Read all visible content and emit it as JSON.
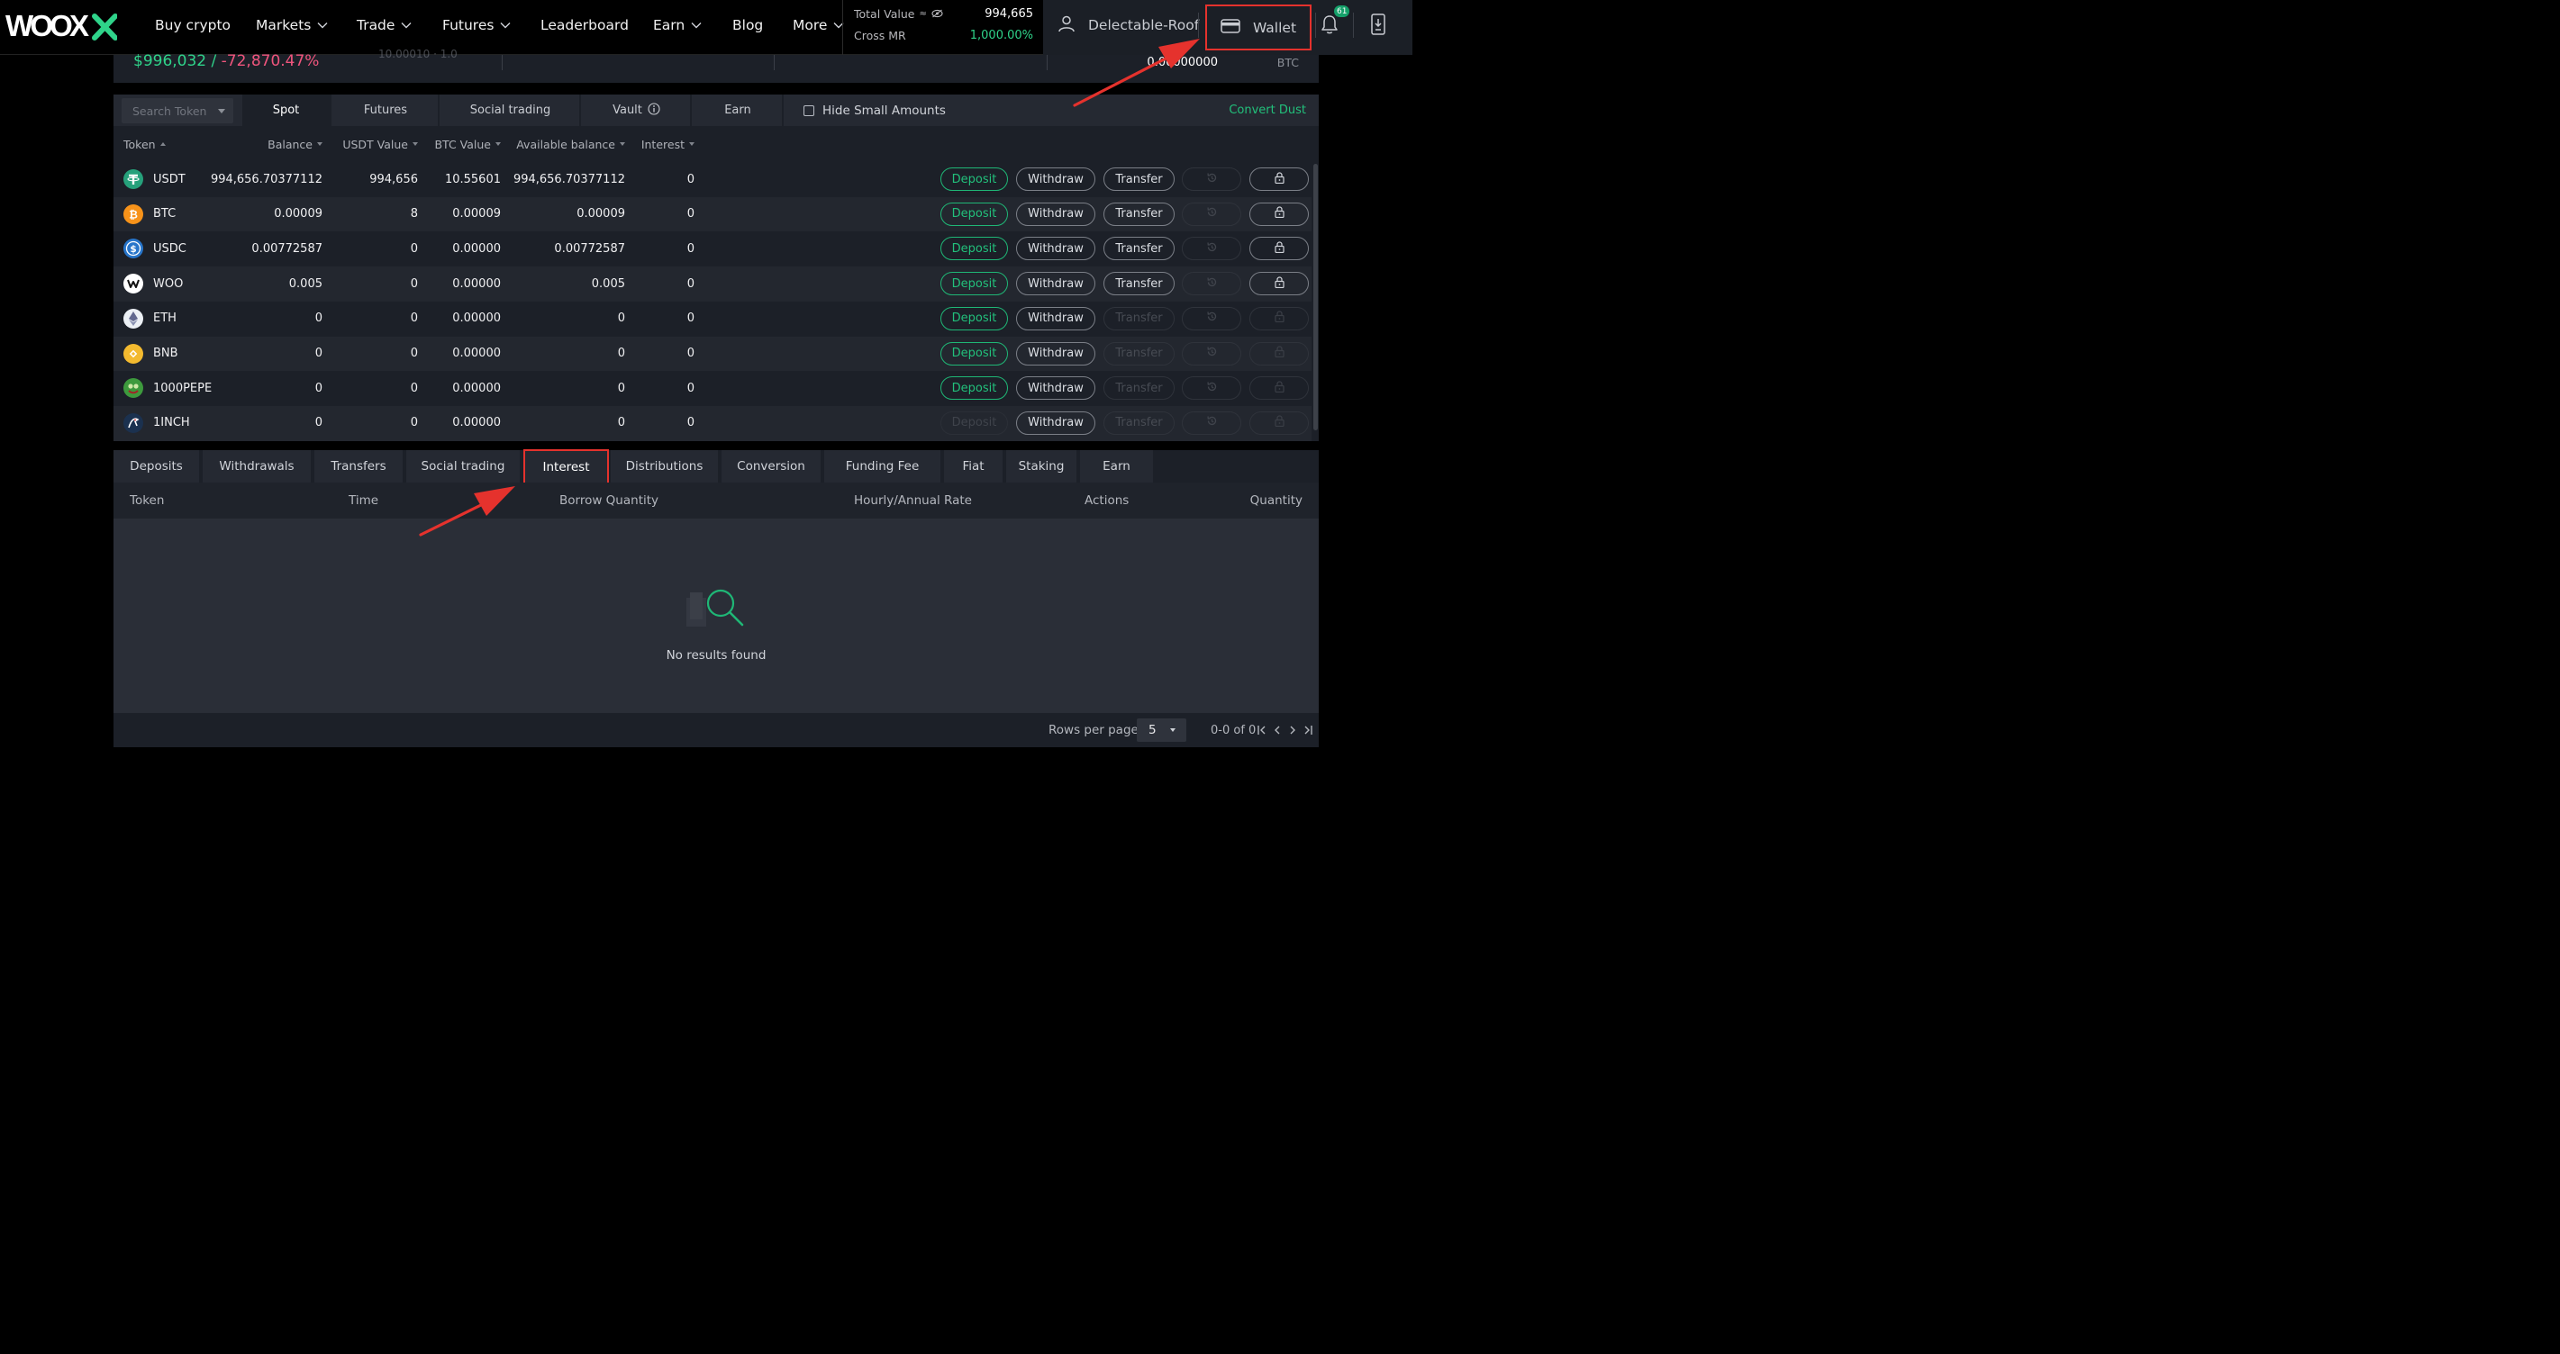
{
  "brand": {
    "logo_text": "WOOX",
    "accent": "#22c07b",
    "negative": "#f0557d",
    "highlight": "#e5322d"
  },
  "nav": {
    "items": [
      {
        "label": "Buy crypto",
        "dropdown": false
      },
      {
        "label": "Markets",
        "dropdown": true
      },
      {
        "label": "Trade",
        "dropdown": true
      },
      {
        "label": "Futures",
        "dropdown": true
      },
      {
        "label": "Leaderboard",
        "dropdown": false
      },
      {
        "label": "Earn",
        "dropdown": true
      },
      {
        "label": "Blog",
        "dropdown": false
      },
      {
        "label": "More",
        "dropdown": true
      }
    ],
    "total_value_label": "Total Value",
    "total_value_symbol": "≈",
    "total_value": "994,665",
    "cross_mr_label": "Cross MR",
    "cross_mr_value": "1,000.00%",
    "username": "Delectable-Roof",
    "wallet_label": "Wallet",
    "notification_count": "61",
    "icons": {
      "user": "user-icon",
      "wallet": "wallet-icon",
      "bell": "bell-icon",
      "download_app": "download-app-icon",
      "hide_balance": "eye-off-icon"
    }
  },
  "summary": {
    "value": "$996,032 /",
    "change": "-72,870.47%",
    "ghost_text": "10.00010 · 1.0",
    "btc_value": "0.00000000",
    "btc_unit": "BTC"
  },
  "balances": {
    "search_placeholder": "Search Token",
    "tabs": [
      {
        "label": "Spot",
        "active": true
      },
      {
        "label": "Futures",
        "active": false
      },
      {
        "label": "Social trading",
        "active": false
      },
      {
        "label": "Vault",
        "active": false,
        "info": true
      },
      {
        "label": "Earn",
        "active": false
      }
    ],
    "hide_small_label": "Hide Small Amounts",
    "hide_small_checked": false,
    "convert_dust_label": "Convert Dust",
    "columns": [
      "Token",
      "Balance",
      "USDT Value",
      "BTC Value",
      "Available balance",
      "Interest"
    ],
    "action_labels": {
      "deposit": "Deposit",
      "withdraw": "Withdraw",
      "transfer": "Transfer"
    },
    "rows": [
      {
        "token": "USDT",
        "balance": "994,656.70377112",
        "usdt_value": "994,656",
        "btc_value": "10.55601",
        "available": "994,656.70377112",
        "interest": "0",
        "deposit_enabled": true,
        "transfer_enabled": true,
        "icon": "usdt-coin-icon",
        "color": "#26a17b"
      },
      {
        "token": "BTC",
        "balance": "0.00009",
        "usdt_value": "8",
        "btc_value": "0.00009",
        "available": "0.00009",
        "interest": "0",
        "deposit_enabled": true,
        "transfer_enabled": true,
        "icon": "btc-coin-icon",
        "color": "#f7931a"
      },
      {
        "token": "USDC",
        "balance": "0.00772587",
        "usdt_value": "0",
        "btc_value": "0.00000",
        "available": "0.00772587",
        "interest": "0",
        "deposit_enabled": true,
        "transfer_enabled": true,
        "icon": "usdc-coin-icon",
        "color": "#2775ca"
      },
      {
        "token": "WOO",
        "balance": "0.005",
        "usdt_value": "0",
        "btc_value": "0.00000",
        "available": "0.005",
        "interest": "0",
        "deposit_enabled": true,
        "transfer_enabled": true,
        "icon": "woo-coin-icon",
        "color": "#ffffff"
      },
      {
        "token": "ETH",
        "balance": "0",
        "usdt_value": "0",
        "btc_value": "0.00000",
        "available": "0",
        "interest": "0",
        "deposit_enabled": true,
        "transfer_enabled": false,
        "icon": "eth-coin-icon",
        "color": "#ecf0f5"
      },
      {
        "token": "BNB",
        "balance": "0",
        "usdt_value": "0",
        "btc_value": "0.00000",
        "available": "0",
        "interest": "0",
        "deposit_enabled": true,
        "transfer_enabled": false,
        "icon": "bnb-coin-icon",
        "color": "#f3ba2f"
      },
      {
        "token": "1000PEPE",
        "balance": "0",
        "usdt_value": "0",
        "btc_value": "0.00000",
        "available": "0",
        "interest": "0",
        "deposit_enabled": true,
        "transfer_enabled": false,
        "icon": "pepe-coin-icon",
        "color": "#3d9a3d"
      },
      {
        "token": "1INCH",
        "balance": "0",
        "usdt_value": "0",
        "btc_value": "0.00000",
        "available": "0",
        "interest": "0",
        "deposit_enabled": false,
        "transfer_enabled": false,
        "icon": "1inch-coin-icon",
        "color": "#1b314f"
      }
    ]
  },
  "history": {
    "tabs": [
      {
        "label": "Deposits",
        "active": false
      },
      {
        "label": "Withdrawals",
        "active": false
      },
      {
        "label": "Transfers",
        "active": false
      },
      {
        "label": "Social trading",
        "active": false
      },
      {
        "label": "Interest",
        "active": true
      },
      {
        "label": "Distributions",
        "active": false
      },
      {
        "label": "Conversion",
        "active": false
      },
      {
        "label": "Funding Fee",
        "active": false
      },
      {
        "label": "Fiat",
        "active": false
      },
      {
        "label": "Staking",
        "active": false
      },
      {
        "label": "Earn",
        "active": false
      }
    ],
    "columns": [
      "Token",
      "Time",
      "Borrow Quantity",
      "Hourly/Annual Rate",
      "Actions",
      "Quantity"
    ],
    "empty_text": "No results found",
    "rows_per_page_label": "Rows per page",
    "rows_per_page": "5",
    "page_info": "0-0 of 0"
  }
}
